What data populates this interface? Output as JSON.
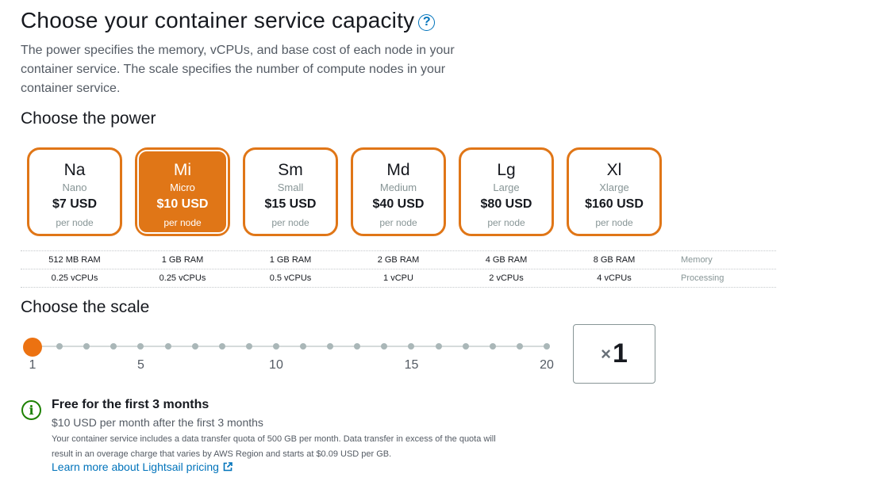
{
  "header": {
    "title": "Choose your container service capacity",
    "help_icon": "question-circle-icon",
    "help_glyph": "?",
    "description": "The power specifies the memory, vCPUs, and base cost of each node in your container service. The scale specifies the number of compute nodes in your container service."
  },
  "power": {
    "heading": "Choose the power",
    "accent_color": "#e07617",
    "cards": [
      {
        "abbr": "Na",
        "name": "Nano",
        "price": "$7 USD",
        "per": "per node",
        "memory": "512 MB RAM",
        "cpu": "0.25 vCPUs",
        "selected": false
      },
      {
        "abbr": "Mi",
        "name": "Micro",
        "price": "$10 USD",
        "per": "per node",
        "memory": "1 GB RAM",
        "cpu": "0.25 vCPUs",
        "selected": true
      },
      {
        "abbr": "Sm",
        "name": "Small",
        "price": "$15 USD",
        "per": "per node",
        "memory": "1 GB RAM",
        "cpu": "0.5 vCPUs",
        "selected": false
      },
      {
        "abbr": "Md",
        "name": "Medium",
        "price": "$40 USD",
        "per": "per node",
        "memory": "2 GB RAM",
        "cpu": "1 vCPU",
        "selected": false
      },
      {
        "abbr": "Lg",
        "name": "Large",
        "price": "$80 USD",
        "per": "per node",
        "memory": "4 GB RAM",
        "cpu": "2 vCPUs",
        "selected": false
      },
      {
        "abbr": "Xl",
        "name": "Xlarge",
        "price": "$160 USD",
        "per": "per node",
        "memory": "8 GB RAM",
        "cpu": "4 vCPUs",
        "selected": false
      }
    ],
    "spec_labels": {
      "memory": "Memory",
      "processing": "Processing"
    }
  },
  "scale": {
    "heading": "Choose the scale",
    "min": 1,
    "max": 20,
    "value": 1,
    "labels": [
      "1",
      "5",
      "10",
      "15",
      "20"
    ],
    "box_prefix": "×",
    "box_value": "1",
    "thumb_color": "#ec7211"
  },
  "info": {
    "icon": "info-circle-icon",
    "icon_glyph": "i",
    "title": "Free for the first 3 months",
    "subtitle": "$10 USD per month after the first 3 months",
    "detail": "Your container service includes a data transfer quota of 500 GB per month. Data transfer in excess of the quota will result in an overage charge that varies by AWS Region and starts at $0.09 USD per GB.",
    "link_text": "Learn more about Lightsail pricing",
    "link_icon": "external-link-icon",
    "success_color": "#1d8102",
    "link_color": "#0073bb"
  }
}
